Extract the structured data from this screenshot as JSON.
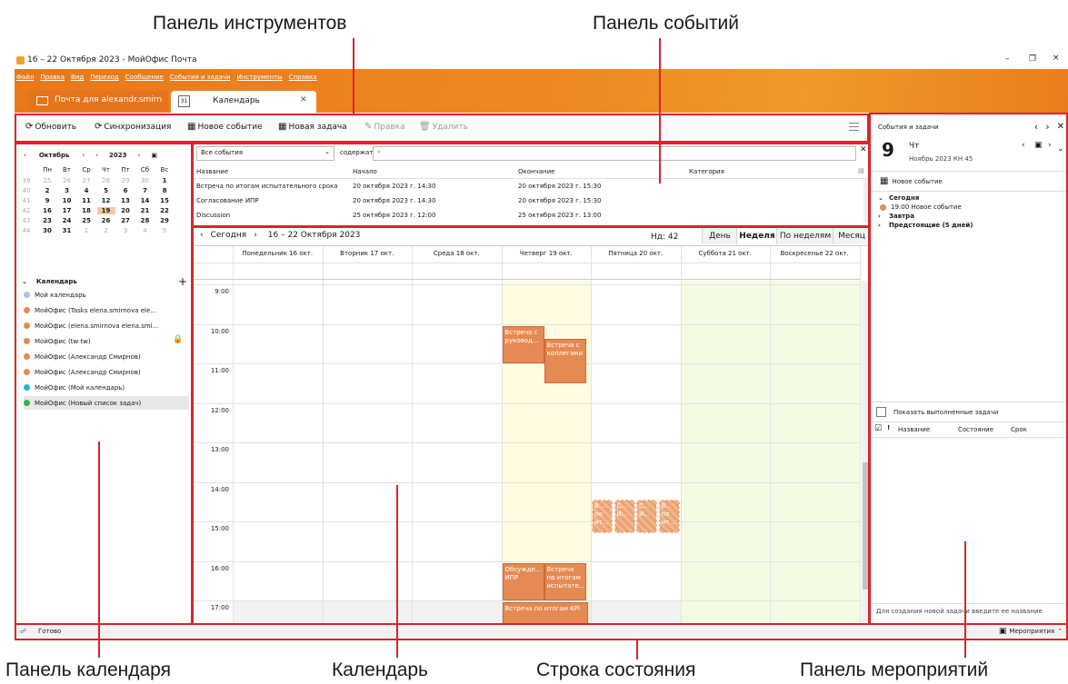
{
  "annotations": {
    "toolbar": "Панель инструментов",
    "events_panel": "Панель событий",
    "calendar_panel": "Панель календаря",
    "calendar": "Календарь",
    "status_bar": "Строка состояния",
    "activities_panel": "Панель мероприятий"
  },
  "window": {
    "title": "16 – 22 Октября 2023 - МойОфис Почта",
    "controls": [
      "–",
      "❐",
      "×"
    ]
  },
  "menu": [
    "Файл",
    "Правка",
    "Вид",
    "Переход",
    "Сообщение",
    "События и задачи",
    "Инструменты",
    "Справка"
  ],
  "tabs": [
    {
      "label": "Почта для alexandr.smirn",
      "active": false
    },
    {
      "label": "Календарь",
      "active": true
    }
  ],
  "toolbar": {
    "refresh": "Обновить",
    "sync": "Синхронизация",
    "new_event": "Новое событие",
    "new_task": "Новая задача",
    "edit": "Правка",
    "delete": "Удалить"
  },
  "mini_calendar": {
    "month": "Октябрь",
    "year": "2023",
    "weekdays": [
      "Пн",
      "Вт",
      "Ср",
      "Чт",
      "Пт",
      "Сб",
      "Вс"
    ],
    "weeks": [
      {
        "num": "39",
        "days": [
          "25",
          "26",
          "27",
          "28",
          "29",
          "30",
          "1"
        ]
      },
      {
        "num": "40",
        "days": [
          "2",
          "3",
          "4",
          "5",
          "6",
          "7",
          "8"
        ]
      },
      {
        "num": "41",
        "days": [
          "9",
          "10",
          "11",
          "12",
          "13",
          "14",
          "15"
        ]
      },
      {
        "num": "42",
        "days": [
          "16",
          "17",
          "18",
          "19",
          "20",
          "21",
          "22"
        ]
      },
      {
        "num": "43",
        "days": [
          "23",
          "24",
          "25",
          "26",
          "27",
          "28",
          "29"
        ]
      },
      {
        "num": "44",
        "days": [
          "30",
          "31",
          "1",
          "2",
          "3",
          "4",
          "5"
        ]
      }
    ]
  },
  "calendars": {
    "header": "Календарь",
    "items": [
      {
        "label": "Мой календарь",
        "color": "#a9c4e8"
      },
      {
        "label": "МойОфис (Tasks elena.smirnova ele...",
        "color": "#e58a52"
      },
      {
        "label": "МойОфис (elena.smirnova elena.smi...",
        "color": "#e58a52"
      },
      {
        "label": "МойОфис (tw tw)",
        "color": "#e58a52"
      },
      {
        "label": "МойОфис (Александр Смирнов)",
        "color": "#e58a52"
      },
      {
        "label": "МойОфис (Александр Смирнов)",
        "color": "#e58a52"
      },
      {
        "label": "МойОфис (Мой календарь)",
        "color": "#27b5d6"
      },
      {
        "label": "МойОфис (Новый список задач)",
        "color": "#2fb34a"
      }
    ]
  },
  "events_panel": {
    "filter": "Все события",
    "contains": "содержат",
    "search_placeholder": "",
    "columns": [
      "Название",
      "Начало",
      "Окончание",
      "Категория"
    ],
    "rows": [
      [
        "Встреча по итогам испытательного срока",
        "20 октября 2023 г. 14:30",
        "20 октября 2023 г. 15:30",
        ""
      ],
      [
        "Согласование ИПР",
        "20 октября 2023 г. 14:30",
        "20 октября 2023 г. 15:30",
        ""
      ],
      [
        "Discussion",
        "25 октября 2023 г. 12:00",
        "25 октября 2023 г. 13:00",
        ""
      ]
    ]
  },
  "calendar_view": {
    "today": "Сегодня",
    "range": "16 – 22 Октября 2023",
    "week": "Нд: 42",
    "views": [
      "День",
      "Неделя",
      "По неделям",
      "Месяц"
    ],
    "active_view": "Неделя",
    "days": [
      "Понедельник 16 окт.",
      "Вторник 17 окт.",
      "Среда 18 окт.",
      "Четверг 19 окт.",
      "Пятница 20 окт.",
      "Суббота 21 окт.",
      "Воскресенье 22 окт."
    ],
    "hours": [
      "9:00",
      "10:00",
      "11:00",
      "12:00",
      "13:00",
      "14:00",
      "15:00",
      "16:00",
      "17:00"
    ],
    "events": [
      {
        "title": "Встреча с руковод...",
        "day": 3,
        "start": 10.0,
        "end": 11.0
      },
      {
        "title": "Встреча с коллегами",
        "day": 3,
        "start": 10.33,
        "end": 11.5,
        "shift": true
      },
      {
        "title": "Обсужде... ИПР",
        "day": 3,
        "start": 16.0,
        "end": 17.0
      },
      {
        "title": "Встреча по итогам испытате...",
        "day": 3,
        "start": 16.0,
        "end": 17.0,
        "shift": true
      },
      {
        "title": "Встреча по итогам KPI",
        "day": 3,
        "start": 17.0,
        "end": 18.0
      }
    ],
    "tentative": [
      {
        "title": "В... по ит...",
        "day": 4,
        "idx": 0
      },
      {
        "title": "С... И...",
        "day": 4,
        "idx": 1
      },
      {
        "title": "С... И...",
        "day": 4,
        "idx": 2
      },
      {
        "title": "В... по ит...",
        "day": 4,
        "idx": 3
      }
    ]
  },
  "today_pane": {
    "header": "События и задачи",
    "day_num": "9",
    "weekday": "Чт",
    "month_info": "Ноябрь 2023  КН 45",
    "new_event": "Новое событие",
    "sections": [
      {
        "label": "Сегодня",
        "expanded": true,
        "items": [
          "19:00 Новое событие"
        ]
      },
      {
        "label": "Завтра",
        "expanded": false,
        "items": []
      },
      {
        "label": "Предстоящие (5 дней)",
        "expanded": false,
        "items": []
      }
    ],
    "show_completed": "Показать выполненные задачи",
    "task_columns": [
      "Название",
      "Состояние",
      "Срок"
    ],
    "new_task_placeholder": "Для создания новой задачи введите ее название"
  },
  "status": {
    "text": "Готово",
    "activities": "Мероприятия"
  }
}
